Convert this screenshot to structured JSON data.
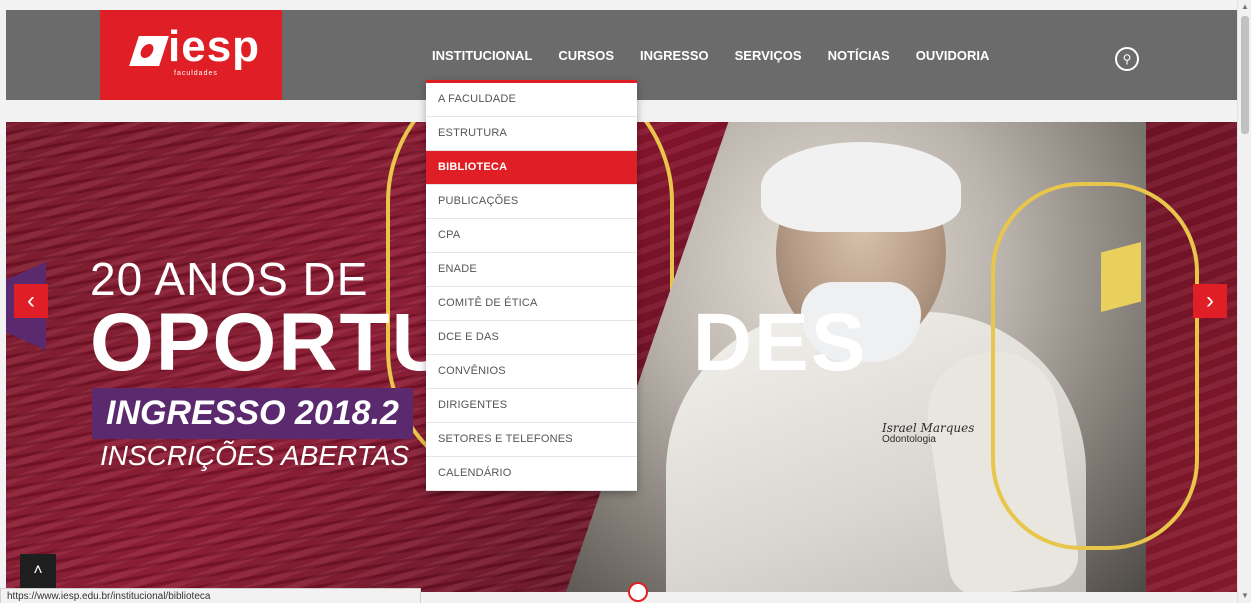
{
  "header": {
    "logo_text": "iesp",
    "logo_subtext": "faculdades",
    "nav": [
      "INSTITUCIONAL",
      "CURSOS",
      "INGRESSO",
      "SERVIÇOS",
      "NOTÍCIAS",
      "OUVIDORIA"
    ],
    "search_icon": "search-icon"
  },
  "dropdown": {
    "items": [
      "A FACULDADE",
      "ESTRUTURA",
      "BIBLIOTECA",
      "PUBLICAÇÕES",
      "CPA",
      "ENADE",
      "COMITÊ DE ÉTICA",
      "DCE E DAS",
      "CONVÊNIOS",
      "DIRIGENTES",
      "SETORES E TELEFONES",
      "CALENDÁRIO"
    ],
    "highlighted": "BIBLIOTECA"
  },
  "hero": {
    "line1": "20 ANOS DE",
    "line2": "OPORTU",
    "line2_tail": "DES",
    "badge": "INGRESSO 2018.2",
    "line4": "INSCRIÇÕES ABERTAS",
    "nametag_name": "Israel Marques",
    "nametag_role": "Odontologia",
    "prev": "‹",
    "next": "›"
  },
  "status_url": "https://www.iesp.edu.br/institucional/biblioteca",
  "colors": {
    "brand_red": "#e01e26",
    "purple": "#5b2a6e",
    "yellow": "#e8c64b"
  }
}
